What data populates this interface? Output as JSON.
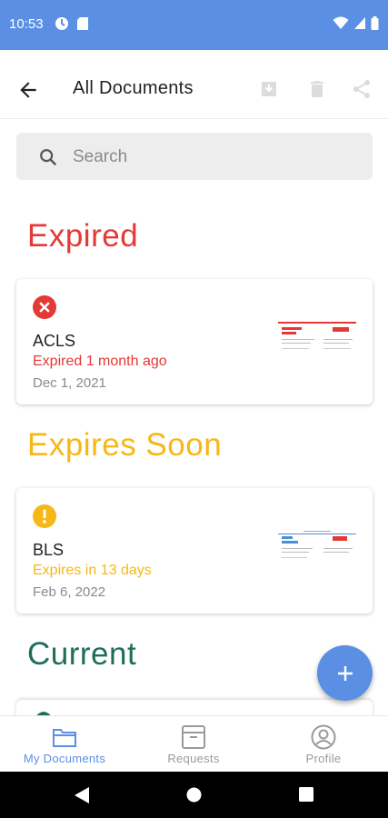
{
  "status_bar": {
    "time": "10:53",
    "color": "#5b8fe3"
  },
  "app_bar": {
    "title": "All Documents",
    "icons": [
      "back-arrow-icon",
      "download-icon",
      "delete-icon",
      "share-icon"
    ]
  },
  "search": {
    "placeholder": "Search",
    "value": ""
  },
  "sections": {
    "expired": {
      "heading": "Expired",
      "color": "#e53935"
    },
    "expires_soon": {
      "heading": "Expires Soon",
      "color": "#f5b816"
    },
    "current": {
      "heading": "Current",
      "color": "#1f6e5c"
    }
  },
  "cards": [
    {
      "name": "ACLS",
      "status_text": "Expired 1 month ago",
      "date": "Dec 1, 2021",
      "status_icon": "error-icon",
      "status_color": "#e53935"
    },
    {
      "name": "BLS",
      "status_text": "Expires in 13 days",
      "date": "Feb 6, 2022",
      "status_icon": "warning-icon",
      "status_color": "#f5b816"
    }
  ],
  "fab": {
    "icon": "plus-icon"
  },
  "bottom_nav": [
    {
      "label": "My Documents",
      "icon": "folder-icon",
      "active": true
    },
    {
      "label": "Requests",
      "icon": "archive-box-icon",
      "active": false
    },
    {
      "label": "Profile",
      "icon": "profile-icon",
      "active": false
    }
  ],
  "colors": {
    "accent": "#5b8fe3",
    "inactive_nav": "#9a9a9a",
    "disabled_icon": "#d9d9d9"
  }
}
